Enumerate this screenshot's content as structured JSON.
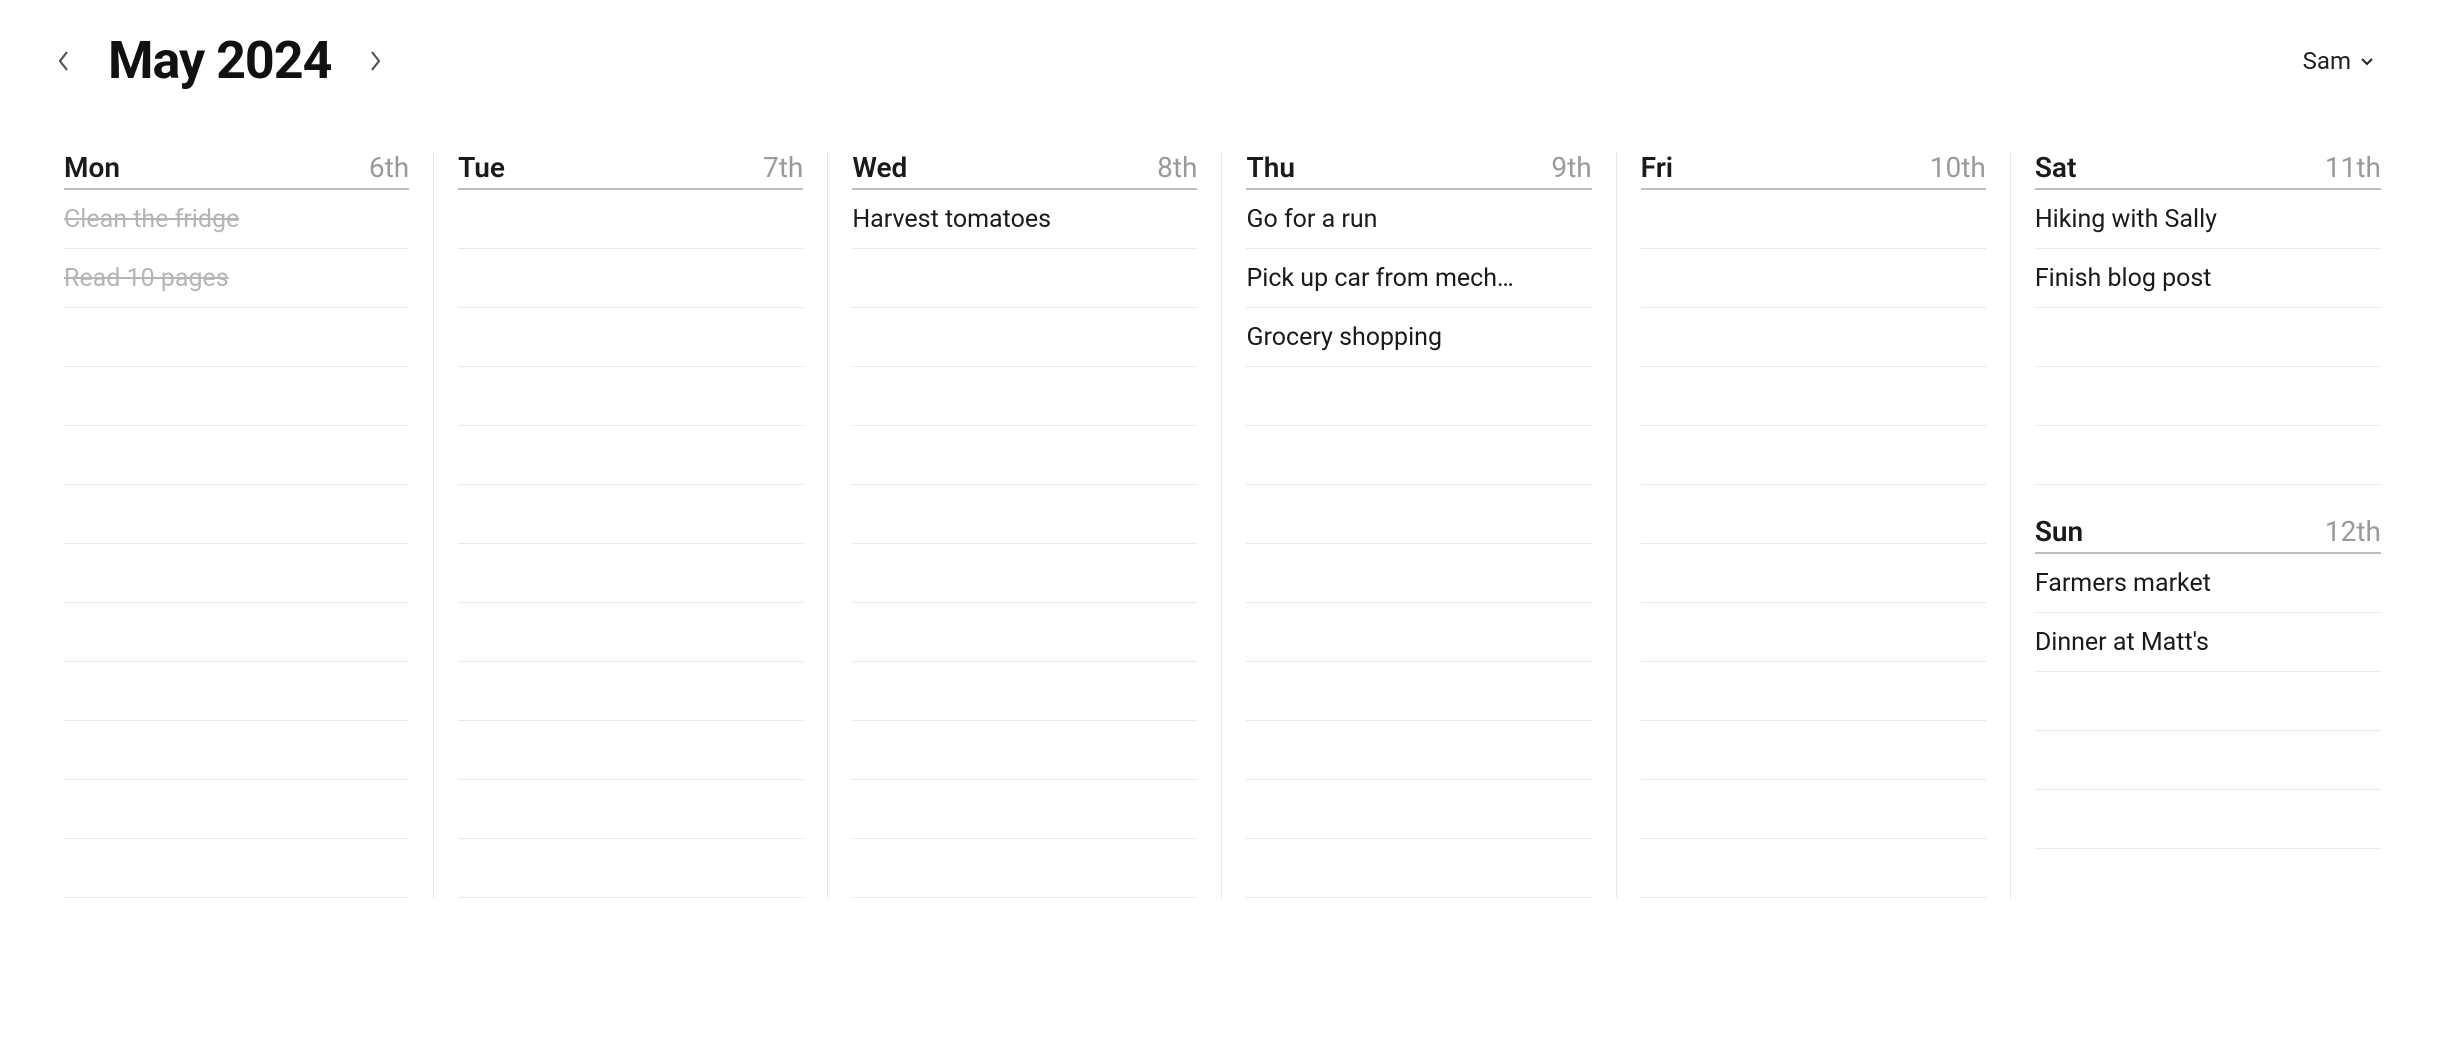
{
  "header": {
    "title": "May 2024",
    "user_name": "Sam"
  },
  "rows_full": 12,
  "rows_half": 5,
  "columns": [
    {
      "name": "Mon",
      "days": [
        {
          "name": "Mon",
          "date": "6th",
          "slots": "full",
          "tasks": [
            {
              "label": "Clean the fridge",
              "done": true
            },
            {
              "label": "Read 10 pages",
              "done": true
            }
          ]
        }
      ]
    },
    {
      "name": "Tue",
      "days": [
        {
          "name": "Tue",
          "date": "7th",
          "slots": "full",
          "tasks": []
        }
      ]
    },
    {
      "name": "Wed",
      "days": [
        {
          "name": "Wed",
          "date": "8th",
          "slots": "full",
          "tasks": [
            {
              "label": "Harvest tomatoes",
              "done": false
            }
          ]
        }
      ]
    },
    {
      "name": "Thu",
      "days": [
        {
          "name": "Thu",
          "date": "9th",
          "slots": "full",
          "tasks": [
            {
              "label": "Go for a run",
              "done": false
            },
            {
              "label": "Pick up car from mech…",
              "done": false
            },
            {
              "label": "Grocery shopping",
              "done": false
            }
          ]
        }
      ]
    },
    {
      "name": "Fri",
      "days": [
        {
          "name": "Fri",
          "date": "10th",
          "slots": "full",
          "tasks": []
        }
      ]
    },
    {
      "name": "SatSun",
      "days": [
        {
          "name": "Sat",
          "date": "11th",
          "slots": "half",
          "tasks": [
            {
              "label": "Hiking with Sally",
              "done": false
            },
            {
              "label": "Finish blog post",
              "done": false
            }
          ]
        },
        {
          "name": "Sun",
          "date": "12th",
          "slots": "half",
          "tasks": [
            {
              "label": "Farmers market",
              "done": false
            },
            {
              "label": "Dinner at Matt's",
              "done": false
            }
          ]
        }
      ]
    }
  ]
}
